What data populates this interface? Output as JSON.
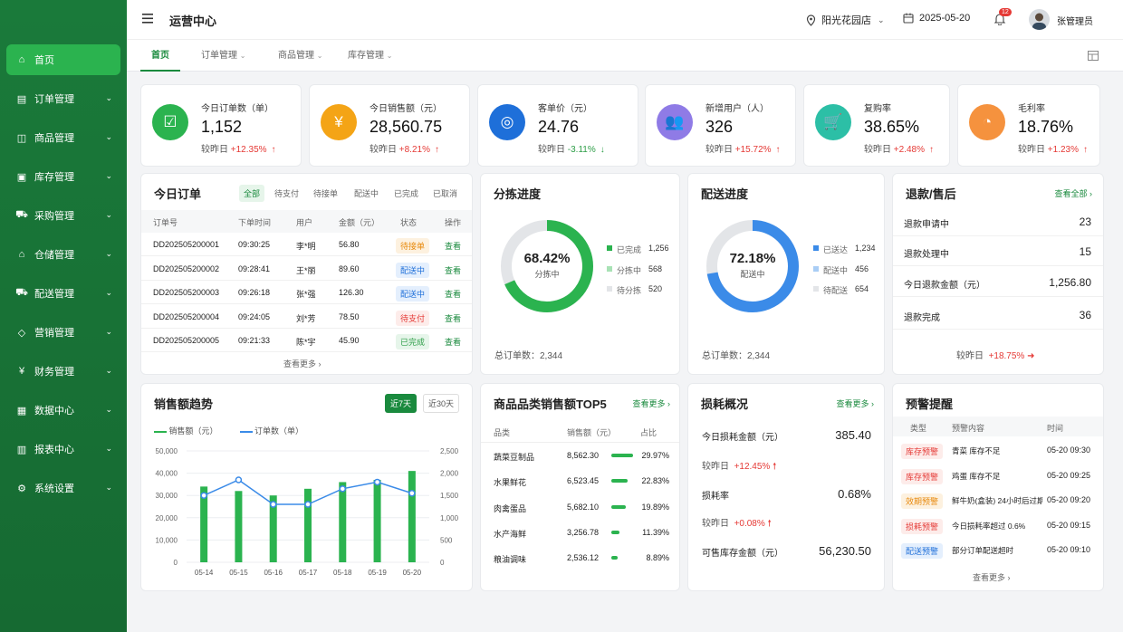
{
  "sidebar": {
    "items": [
      {
        "label": "首页",
        "icon": "home-icon",
        "active": true
      },
      {
        "label": "订单管理",
        "icon": "document-icon"
      },
      {
        "label": "商品管理",
        "icon": "bag-icon"
      },
      {
        "label": "库存管理",
        "icon": "box-icon"
      },
      {
        "label": "采购管理",
        "icon": "cart-icon"
      },
      {
        "label": "仓储管理",
        "icon": "warehouse-icon"
      },
      {
        "label": "配送管理",
        "icon": "truck-icon"
      },
      {
        "label": "营销管理",
        "icon": "tag-icon"
      },
      {
        "label": "财务管理",
        "icon": "yuan-icon"
      },
      {
        "label": "数据中心",
        "icon": "data-icon"
      },
      {
        "label": "报表中心",
        "icon": "report-icon"
      },
      {
        "label": "系统设置",
        "icon": "gear-icon"
      }
    ]
  },
  "header": {
    "title": "运营中心",
    "store": "阳光花园店",
    "date": "2025-05-20",
    "notifications": "12",
    "user": "张管理员"
  },
  "tabs": [
    {
      "label": "首页"
    },
    {
      "label": "订单管理"
    },
    {
      "label": "商品管理"
    },
    {
      "label": "库存管理"
    }
  ],
  "kpis": [
    {
      "label": "今日订单数（单）",
      "value": "1,152",
      "cmp_label": "较昨日",
      "change": "+12.35%",
      "dir": "up",
      "color": "#2bb34f",
      "icon": "clipboard-icon"
    },
    {
      "label": "今日销售额（元）",
      "value": "28,560.75",
      "cmp_label": "较昨日",
      "change": "+8.21%",
      "dir": "up",
      "color": "#f4a416",
      "icon": "yuan-doc-icon"
    },
    {
      "label": "客单价（元）",
      "value": "24.76",
      "cmp_label": "较昨日",
      "change": "-3.11%",
      "dir": "down",
      "color": "#1e6fd9",
      "icon": "coins-icon"
    },
    {
      "label": "新增用户（人）",
      "value": "326",
      "cmp_label": "较昨日",
      "change": "+15.72%",
      "dir": "up",
      "color": "#8f7be6",
      "icon": "users-icon"
    },
    {
      "label": "复购率",
      "value": "38.65%",
      "cmp_label": "较昨日",
      "change": "+2.48%",
      "dir": "up",
      "color": "#2cbfa6",
      "icon": "cart-icon"
    },
    {
      "label": "毛利率",
      "value": "18.76%",
      "cmp_label": "较昨日",
      "change": "+1.23%",
      "dir": "up",
      "color": "#f5923e",
      "icon": "pie-icon"
    }
  ],
  "orders": {
    "title": "今日订单",
    "filters": [
      "全部",
      "待支付",
      "待接单",
      "配送中",
      "已完成",
      "已取消"
    ],
    "columns": [
      "订单号",
      "下单时间",
      "用户",
      "金额（元）",
      "状态",
      "操作"
    ],
    "rows": [
      {
        "id": "DD202505200001",
        "time": "09:30:25",
        "user": "李*明",
        "amount": "56.80",
        "status": "待接单",
        "action": "查看"
      },
      {
        "id": "DD202505200002",
        "time": "09:28:41",
        "user": "王*丽",
        "amount": "89.60",
        "status": "配送中",
        "action": "查看"
      },
      {
        "id": "DD202505200003",
        "time": "09:26:18",
        "user": "张*强",
        "amount": "126.30",
        "status": "配送中",
        "action": "查看"
      },
      {
        "id": "DD202505200004",
        "time": "09:24:05",
        "user": "刘*芳",
        "amount": "78.50",
        "status": "待支付",
        "action": "查看"
      },
      {
        "id": "DD202505200005",
        "time": "09:21:33",
        "user": "陈*宇",
        "amount": "45.90",
        "status": "已完成",
        "action": "查看"
      }
    ],
    "more": "查看更多"
  },
  "sorting": {
    "title": "分拣进度",
    "percent": "68.42%",
    "fraction": 0.6842,
    "sub": "分拣中",
    "legend": [
      {
        "label": "已完成",
        "value": "1,256",
        "color": "#2bb34f"
      },
      {
        "label": "分拣中",
        "value": "568",
        "color": "#a8e2b5"
      },
      {
        "label": "待分拣",
        "value": "520",
        "color": "#e3e5e8"
      }
    ],
    "total": "总订单数：2,344"
  },
  "delivery": {
    "title": "配送进度",
    "percent": "72.18%",
    "fraction": 0.7218,
    "sub": "配送中",
    "legend": [
      {
        "label": "已送达",
        "value": "1,234",
        "color": "#3b8be8"
      },
      {
        "label": "配送中",
        "value": "456",
        "color": "#a9cdf5"
      },
      {
        "label": "待配送",
        "value": "654",
        "color": "#e3e5e8"
      }
    ],
    "total": "总订单数：2,344"
  },
  "refund": {
    "title": "退款/售后",
    "link": "查看全部",
    "rows": [
      {
        "label": "退款申请中",
        "value": "23"
      },
      {
        "label": "退款处理中",
        "value": "15"
      },
      {
        "label": "今日退款金额（元）",
        "value": "1,256.80"
      },
      {
        "label": "退款完成",
        "value": "36"
      }
    ],
    "cmp_label": "较昨日",
    "change": "+18.75%"
  },
  "trend": {
    "title": "销售额趋势",
    "btn7": "近7天",
    "btn30": "近30天"
  },
  "chart_data": {
    "type": "bar",
    "title": "销售额趋势",
    "categories": [
      "05-14",
      "05-15",
      "05-16",
      "05-17",
      "05-18",
      "05-19",
      "05-20"
    ],
    "series": [
      {
        "name": "销售额（元）",
        "type": "bar",
        "values": [
          34000,
          32000,
          30000,
          33000,
          36000,
          37000,
          41000
        ]
      },
      {
        "name": "订单数（单）",
        "type": "line",
        "values": [
          1500,
          1850,
          1300,
          1300,
          1650,
          1800,
          1550
        ]
      }
    ],
    "yleft": {
      "ticks": [
        "0",
        "10,000",
        "20,000",
        "30,000",
        "40,000",
        "50,000"
      ],
      "range": [
        0,
        50000
      ]
    },
    "yright": {
      "ticks": [
        "0",
        "500",
        "1,000",
        "1,500",
        "2,000",
        "2,500"
      ],
      "range": [
        0,
        2500
      ]
    },
    "legend": "top-left"
  },
  "top5": {
    "title": "商品品类销售额TOP5",
    "link": "查看更多",
    "columns": [
      "品类",
      "销售额（元）",
      "占比"
    ],
    "rows": [
      {
        "name": "蔬菜豆制品",
        "amount": "8,562.30",
        "pct": "29.97%",
        "frac": 0.2997
      },
      {
        "name": "水果鲜花",
        "amount": "6,523.45",
        "pct": "22.83%",
        "frac": 0.2283
      },
      {
        "name": "肉禽蛋品",
        "amount": "5,682.10",
        "pct": "19.89%",
        "frac": 0.1989
      },
      {
        "name": "水产海鲜",
        "amount": "3,256.78",
        "pct": "11.39%",
        "frac": 0.1139
      },
      {
        "name": "粮油调味",
        "amount": "2,536.12",
        "pct": "8.89%",
        "frac": 0.0889
      }
    ]
  },
  "loss": {
    "title": "损耗概况",
    "link": "查看更多",
    "amount_label": "今日损耗金额（元）",
    "amount": "385.40",
    "amount_cmp": "较昨日",
    "amount_change": "+12.45%",
    "rate_label": "损耗率",
    "rate": "0.68%",
    "rate_cmp": "较昨日",
    "rate_change": "+0.08%",
    "stock_label": "可售库存金额（元）",
    "stock": "56,230.50"
  },
  "alerts": {
    "title": "预警提醒",
    "columns": [
      "类型",
      "预警内容",
      "时间"
    ],
    "rows": [
      {
        "type": "库存预警",
        "content": "青菜 库存不足",
        "time": "05-20 09:30",
        "color": "#e53935",
        "bg": "#fdecea"
      },
      {
        "type": "库存预警",
        "content": "鸡蛋 库存不足",
        "time": "05-20 09:25",
        "color": "#e53935",
        "bg": "#fdecea"
      },
      {
        "type": "效期预警",
        "content": "鲜牛奶(盒装) 24小时后过期",
        "time": "05-20 09:20",
        "color": "#e8890c",
        "bg": "#fdf1df"
      },
      {
        "type": "损耗预警",
        "content": "今日损耗率超过 0.6%",
        "time": "05-20 09:15",
        "color": "#e53935",
        "bg": "#fdecea"
      },
      {
        "type": "配送预警",
        "content": "部分订单配送超时",
        "time": "05-20 09:10",
        "color": "#1e6fd9",
        "bg": "#e4effd"
      }
    ],
    "more": "查看更多"
  }
}
